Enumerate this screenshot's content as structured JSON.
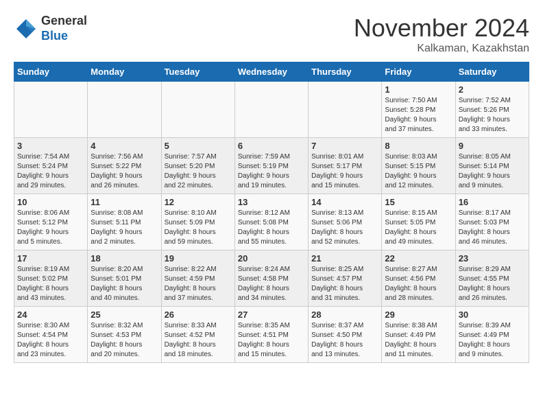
{
  "header": {
    "logo_general": "General",
    "logo_blue": "Blue",
    "month_title": "November 2024",
    "location": "Kalkaman, Kazakhstan"
  },
  "weekdays": [
    "Sunday",
    "Monday",
    "Tuesday",
    "Wednesday",
    "Thursday",
    "Friday",
    "Saturday"
  ],
  "weeks": [
    [
      {
        "day": "",
        "info": ""
      },
      {
        "day": "",
        "info": ""
      },
      {
        "day": "",
        "info": ""
      },
      {
        "day": "",
        "info": ""
      },
      {
        "day": "",
        "info": ""
      },
      {
        "day": "1",
        "info": "Sunrise: 7:50 AM\nSunset: 5:28 PM\nDaylight: 9 hours\nand 37 minutes."
      },
      {
        "day": "2",
        "info": "Sunrise: 7:52 AM\nSunset: 5:26 PM\nDaylight: 9 hours\nand 33 minutes."
      }
    ],
    [
      {
        "day": "3",
        "info": "Sunrise: 7:54 AM\nSunset: 5:24 PM\nDaylight: 9 hours\nand 29 minutes."
      },
      {
        "day": "4",
        "info": "Sunrise: 7:56 AM\nSunset: 5:22 PM\nDaylight: 9 hours\nand 26 minutes."
      },
      {
        "day": "5",
        "info": "Sunrise: 7:57 AM\nSunset: 5:20 PM\nDaylight: 9 hours\nand 22 minutes."
      },
      {
        "day": "6",
        "info": "Sunrise: 7:59 AM\nSunset: 5:19 PM\nDaylight: 9 hours\nand 19 minutes."
      },
      {
        "day": "7",
        "info": "Sunrise: 8:01 AM\nSunset: 5:17 PM\nDaylight: 9 hours\nand 15 minutes."
      },
      {
        "day": "8",
        "info": "Sunrise: 8:03 AM\nSunset: 5:15 PM\nDaylight: 9 hours\nand 12 minutes."
      },
      {
        "day": "9",
        "info": "Sunrise: 8:05 AM\nSunset: 5:14 PM\nDaylight: 9 hours\nand 9 minutes."
      }
    ],
    [
      {
        "day": "10",
        "info": "Sunrise: 8:06 AM\nSunset: 5:12 PM\nDaylight: 9 hours\nand 5 minutes."
      },
      {
        "day": "11",
        "info": "Sunrise: 8:08 AM\nSunset: 5:11 PM\nDaylight: 9 hours\nand 2 minutes."
      },
      {
        "day": "12",
        "info": "Sunrise: 8:10 AM\nSunset: 5:09 PM\nDaylight: 8 hours\nand 59 minutes."
      },
      {
        "day": "13",
        "info": "Sunrise: 8:12 AM\nSunset: 5:08 PM\nDaylight: 8 hours\nand 55 minutes."
      },
      {
        "day": "14",
        "info": "Sunrise: 8:13 AM\nSunset: 5:06 PM\nDaylight: 8 hours\nand 52 minutes."
      },
      {
        "day": "15",
        "info": "Sunrise: 8:15 AM\nSunset: 5:05 PM\nDaylight: 8 hours\nand 49 minutes."
      },
      {
        "day": "16",
        "info": "Sunrise: 8:17 AM\nSunset: 5:03 PM\nDaylight: 8 hours\nand 46 minutes."
      }
    ],
    [
      {
        "day": "17",
        "info": "Sunrise: 8:19 AM\nSunset: 5:02 PM\nDaylight: 8 hours\nand 43 minutes."
      },
      {
        "day": "18",
        "info": "Sunrise: 8:20 AM\nSunset: 5:01 PM\nDaylight: 8 hours\nand 40 minutes."
      },
      {
        "day": "19",
        "info": "Sunrise: 8:22 AM\nSunset: 4:59 PM\nDaylight: 8 hours\nand 37 minutes."
      },
      {
        "day": "20",
        "info": "Sunrise: 8:24 AM\nSunset: 4:58 PM\nDaylight: 8 hours\nand 34 minutes."
      },
      {
        "day": "21",
        "info": "Sunrise: 8:25 AM\nSunset: 4:57 PM\nDaylight: 8 hours\nand 31 minutes."
      },
      {
        "day": "22",
        "info": "Sunrise: 8:27 AM\nSunset: 4:56 PM\nDaylight: 8 hours\nand 28 minutes."
      },
      {
        "day": "23",
        "info": "Sunrise: 8:29 AM\nSunset: 4:55 PM\nDaylight: 8 hours\nand 26 minutes."
      }
    ],
    [
      {
        "day": "24",
        "info": "Sunrise: 8:30 AM\nSunset: 4:54 PM\nDaylight: 8 hours\nand 23 minutes."
      },
      {
        "day": "25",
        "info": "Sunrise: 8:32 AM\nSunset: 4:53 PM\nDaylight: 8 hours\nand 20 minutes."
      },
      {
        "day": "26",
        "info": "Sunrise: 8:33 AM\nSunset: 4:52 PM\nDaylight: 8 hours\nand 18 minutes."
      },
      {
        "day": "27",
        "info": "Sunrise: 8:35 AM\nSunset: 4:51 PM\nDaylight: 8 hours\nand 15 minutes."
      },
      {
        "day": "28",
        "info": "Sunrise: 8:37 AM\nSunset: 4:50 PM\nDaylight: 8 hours\nand 13 minutes."
      },
      {
        "day": "29",
        "info": "Sunrise: 8:38 AM\nSunset: 4:49 PM\nDaylight: 8 hours\nand 11 minutes."
      },
      {
        "day": "30",
        "info": "Sunrise: 8:39 AM\nSunset: 4:49 PM\nDaylight: 8 hours\nand 9 minutes."
      }
    ]
  ]
}
